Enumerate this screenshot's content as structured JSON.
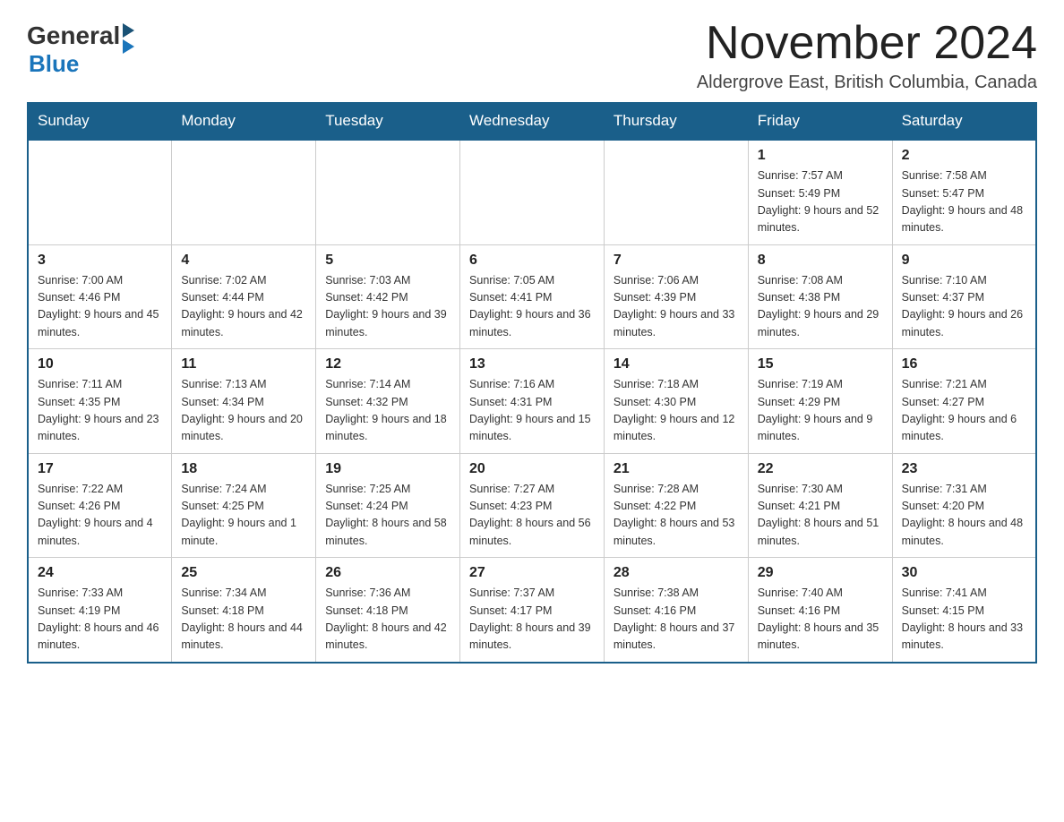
{
  "logo": {
    "general": "General",
    "blue": "Blue",
    "arrow": "▶"
  },
  "title": "November 2024",
  "location": "Aldergrove East, British Columbia, Canada",
  "days_of_week": [
    "Sunday",
    "Monday",
    "Tuesday",
    "Wednesday",
    "Thursday",
    "Friday",
    "Saturday"
  ],
  "weeks": [
    [
      {
        "day": "",
        "info": ""
      },
      {
        "day": "",
        "info": ""
      },
      {
        "day": "",
        "info": ""
      },
      {
        "day": "",
        "info": ""
      },
      {
        "day": "",
        "info": ""
      },
      {
        "day": "1",
        "info": "Sunrise: 7:57 AM\nSunset: 5:49 PM\nDaylight: 9 hours and 52 minutes."
      },
      {
        "day": "2",
        "info": "Sunrise: 7:58 AM\nSunset: 5:47 PM\nDaylight: 9 hours and 48 minutes."
      }
    ],
    [
      {
        "day": "3",
        "info": "Sunrise: 7:00 AM\nSunset: 4:46 PM\nDaylight: 9 hours and 45 minutes."
      },
      {
        "day": "4",
        "info": "Sunrise: 7:02 AM\nSunset: 4:44 PM\nDaylight: 9 hours and 42 minutes."
      },
      {
        "day": "5",
        "info": "Sunrise: 7:03 AM\nSunset: 4:42 PM\nDaylight: 9 hours and 39 minutes."
      },
      {
        "day": "6",
        "info": "Sunrise: 7:05 AM\nSunset: 4:41 PM\nDaylight: 9 hours and 36 minutes."
      },
      {
        "day": "7",
        "info": "Sunrise: 7:06 AM\nSunset: 4:39 PM\nDaylight: 9 hours and 33 minutes."
      },
      {
        "day": "8",
        "info": "Sunrise: 7:08 AM\nSunset: 4:38 PM\nDaylight: 9 hours and 29 minutes."
      },
      {
        "day": "9",
        "info": "Sunrise: 7:10 AM\nSunset: 4:37 PM\nDaylight: 9 hours and 26 minutes."
      }
    ],
    [
      {
        "day": "10",
        "info": "Sunrise: 7:11 AM\nSunset: 4:35 PM\nDaylight: 9 hours and 23 minutes."
      },
      {
        "day": "11",
        "info": "Sunrise: 7:13 AM\nSunset: 4:34 PM\nDaylight: 9 hours and 20 minutes."
      },
      {
        "day": "12",
        "info": "Sunrise: 7:14 AM\nSunset: 4:32 PM\nDaylight: 9 hours and 18 minutes."
      },
      {
        "day": "13",
        "info": "Sunrise: 7:16 AM\nSunset: 4:31 PM\nDaylight: 9 hours and 15 minutes."
      },
      {
        "day": "14",
        "info": "Sunrise: 7:18 AM\nSunset: 4:30 PM\nDaylight: 9 hours and 12 minutes."
      },
      {
        "day": "15",
        "info": "Sunrise: 7:19 AM\nSunset: 4:29 PM\nDaylight: 9 hours and 9 minutes."
      },
      {
        "day": "16",
        "info": "Sunrise: 7:21 AM\nSunset: 4:27 PM\nDaylight: 9 hours and 6 minutes."
      }
    ],
    [
      {
        "day": "17",
        "info": "Sunrise: 7:22 AM\nSunset: 4:26 PM\nDaylight: 9 hours and 4 minutes."
      },
      {
        "day": "18",
        "info": "Sunrise: 7:24 AM\nSunset: 4:25 PM\nDaylight: 9 hours and 1 minute."
      },
      {
        "day": "19",
        "info": "Sunrise: 7:25 AM\nSunset: 4:24 PM\nDaylight: 8 hours and 58 minutes."
      },
      {
        "day": "20",
        "info": "Sunrise: 7:27 AM\nSunset: 4:23 PM\nDaylight: 8 hours and 56 minutes."
      },
      {
        "day": "21",
        "info": "Sunrise: 7:28 AM\nSunset: 4:22 PM\nDaylight: 8 hours and 53 minutes."
      },
      {
        "day": "22",
        "info": "Sunrise: 7:30 AM\nSunset: 4:21 PM\nDaylight: 8 hours and 51 minutes."
      },
      {
        "day": "23",
        "info": "Sunrise: 7:31 AM\nSunset: 4:20 PM\nDaylight: 8 hours and 48 minutes."
      }
    ],
    [
      {
        "day": "24",
        "info": "Sunrise: 7:33 AM\nSunset: 4:19 PM\nDaylight: 8 hours and 46 minutes."
      },
      {
        "day": "25",
        "info": "Sunrise: 7:34 AM\nSunset: 4:18 PM\nDaylight: 8 hours and 44 minutes."
      },
      {
        "day": "26",
        "info": "Sunrise: 7:36 AM\nSunset: 4:18 PM\nDaylight: 8 hours and 42 minutes."
      },
      {
        "day": "27",
        "info": "Sunrise: 7:37 AM\nSunset: 4:17 PM\nDaylight: 8 hours and 39 minutes."
      },
      {
        "day": "28",
        "info": "Sunrise: 7:38 AM\nSunset: 4:16 PM\nDaylight: 8 hours and 37 minutes."
      },
      {
        "day": "29",
        "info": "Sunrise: 7:40 AM\nSunset: 4:16 PM\nDaylight: 8 hours and 35 minutes."
      },
      {
        "day": "30",
        "info": "Sunrise: 7:41 AM\nSunset: 4:15 PM\nDaylight: 8 hours and 33 minutes."
      }
    ]
  ]
}
